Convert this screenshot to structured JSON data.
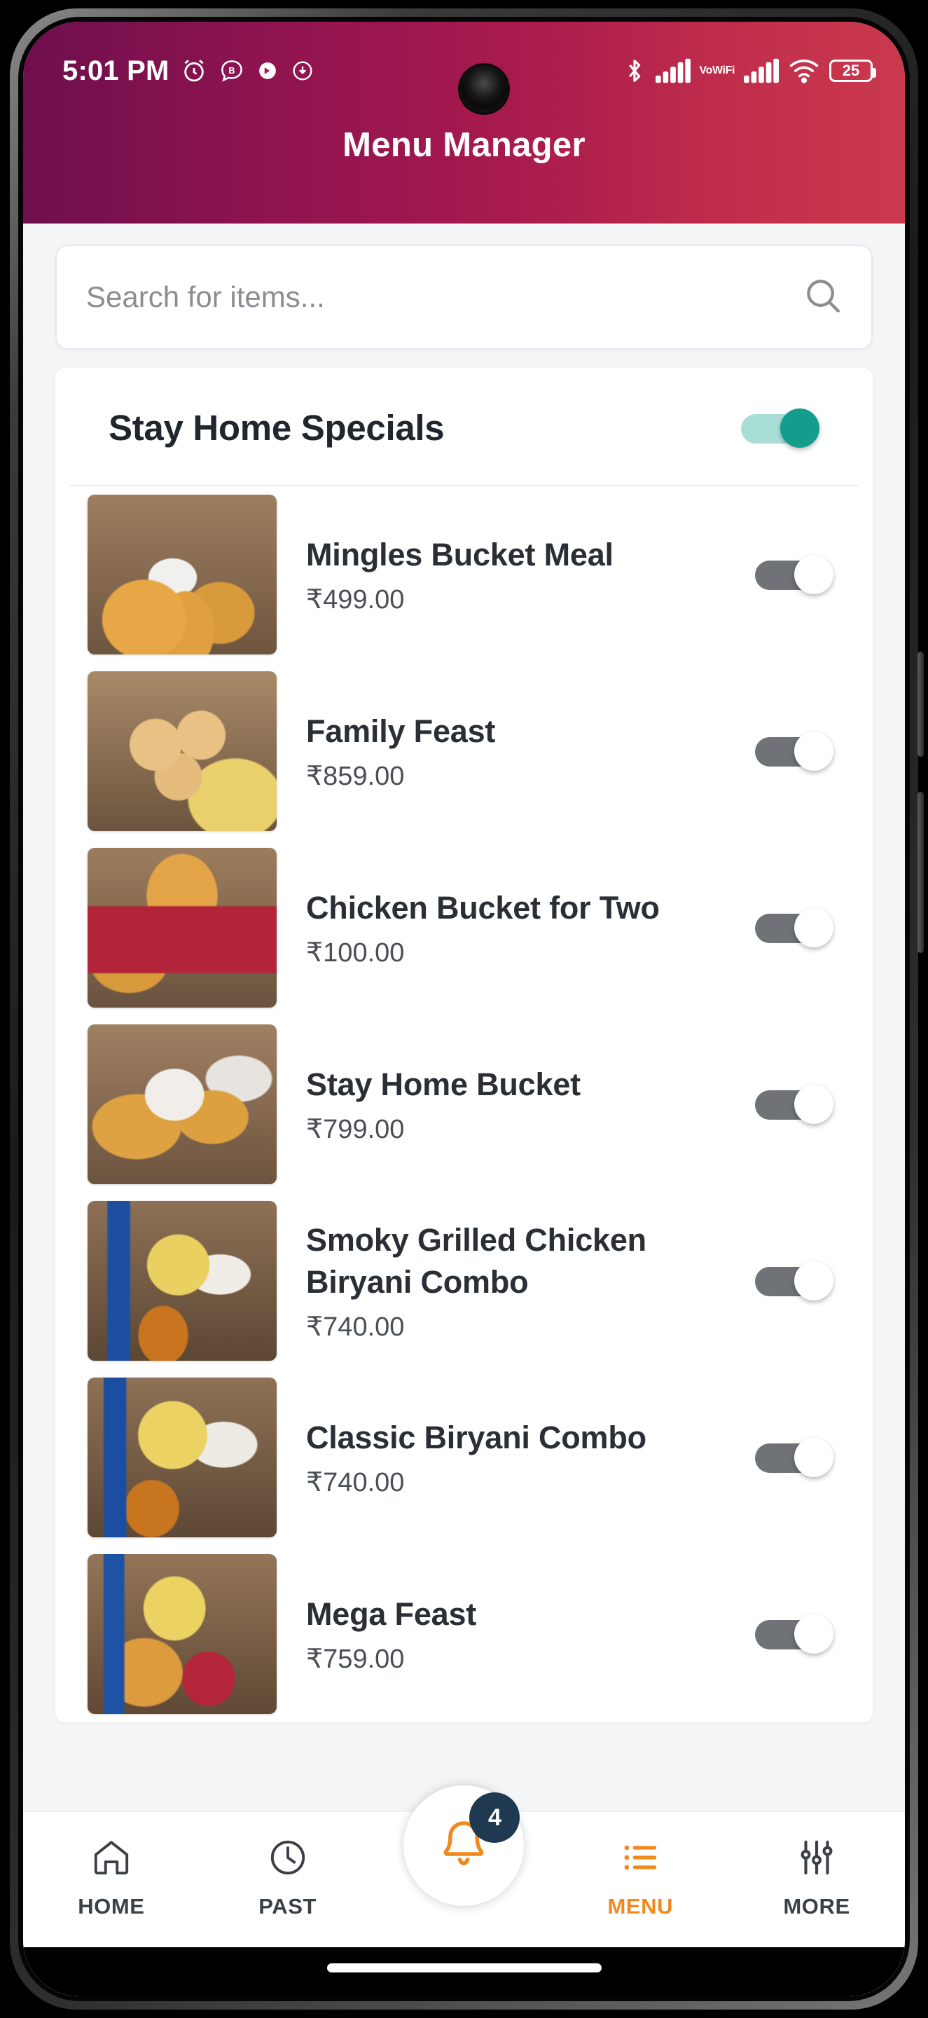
{
  "status_bar": {
    "time": "5:01 PM",
    "left_icons": [
      "alarm-clock-icon",
      "chat-b-icon",
      "circle-arrow-icon",
      "download-circle-icon"
    ],
    "right_icons": [
      "bluetooth-icon",
      "signal-bars-icon",
      "vowifi-icon",
      "signal-bars-2-icon",
      "wifi-icon",
      "battery-icon"
    ],
    "vowifi_line1": "Vo",
    "vowifi_line2": "WiFi",
    "battery_level": "25"
  },
  "app_bar": {
    "title": "Menu Manager",
    "gradient_start": "#6e0f4c",
    "gradient_end": "#ca3a4d"
  },
  "search": {
    "placeholder": "Search for items...",
    "value": "",
    "icon": "search-icon"
  },
  "section": {
    "title": "Stay Home Specials",
    "toggle_state": "on",
    "toggle_on_color": "#149c8c",
    "toggle_off_color": "#6f7377"
  },
  "items": [
    {
      "name": "Mingles Bucket Meal",
      "price": "₹499.00",
      "toggle_state": "off",
      "thumb_class": "f1"
    },
    {
      "name": "Family Feast",
      "price": "₹859.00",
      "toggle_state": "off",
      "thumb_class": "f2"
    },
    {
      "name": "Chicken Bucket for Two",
      "price": "₹100.00",
      "toggle_state": "off",
      "thumb_class": "f3"
    },
    {
      "name": "Stay Home Bucket",
      "price": "₹799.00",
      "toggle_state": "off",
      "thumb_class": "f4"
    },
    {
      "name": "Smoky Grilled Chicken Biryani Combo",
      "price": "₹740.00",
      "toggle_state": "off",
      "thumb_class": "f5"
    },
    {
      "name": "Classic Biryani Combo",
      "price": "₹740.00",
      "toggle_state": "off",
      "thumb_class": "f6"
    },
    {
      "name": "Mega Feast",
      "price": "₹759.00",
      "toggle_state": "off",
      "thumb_class": "f7"
    }
  ],
  "bottom_nav": {
    "active_color": "#f08a1e",
    "inactive_color": "#3b4048",
    "notification_badge": "4",
    "items": [
      {
        "label": "HOME",
        "icon": "home-icon",
        "active": false
      },
      {
        "label": "PAST",
        "icon": "clock-icon",
        "active": false
      },
      {
        "label": "MENU",
        "icon": "list-icon",
        "active": true
      },
      {
        "label": "MORE",
        "icon": "sliders-icon",
        "active": false
      }
    ]
  }
}
